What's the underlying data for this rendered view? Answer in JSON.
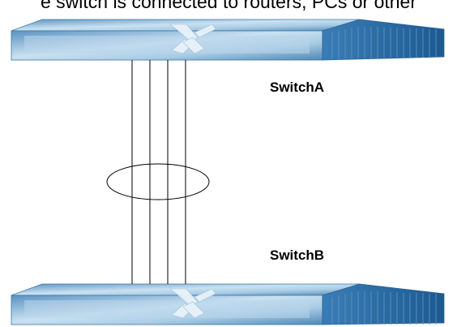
{
  "caption_fragment": "e switch is connected to routers, PCs or other",
  "switches": [
    {
      "label": "SwitchA"
    },
    {
      "label": "SwitchB"
    }
  ],
  "links": {
    "count": 4
  },
  "colors": {
    "switch_top_light": "#cfe4f2",
    "switch_top_mid": "#8fbbd9",
    "switch_top_dark": "#4f88b6",
    "switch_side": "#2e6fa8",
    "switch_side_dark": "#1d5a91",
    "line": "#000000"
  }
}
